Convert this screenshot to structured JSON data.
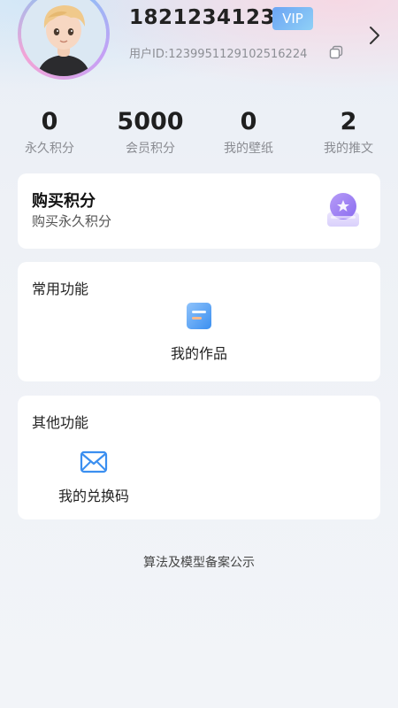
{
  "profile": {
    "phone": "18212341234",
    "vip_label": "VIP",
    "user_id": "用户ID:1239951129102516224"
  },
  "stats": [
    {
      "value": "0",
      "label": "永久积分"
    },
    {
      "value": "5000",
      "label": "会员积分"
    },
    {
      "value": "0",
      "label": "我的壁纸"
    },
    {
      "value": "2",
      "label": "我的推文"
    }
  ],
  "buy_card": {
    "title": "购买积分",
    "subtitle": "购买永久积分"
  },
  "common_functions": {
    "title": "常用功能",
    "items": [
      {
        "label": "我的作品",
        "icon": "document-icon"
      }
    ]
  },
  "other_functions": {
    "title": "其他功能",
    "items": [
      {
        "label": "我的兑换码",
        "icon": "envelope-icon"
      }
    ]
  },
  "footer": {
    "link": "算法及模型备案公示"
  },
  "colors": {
    "vip_gradient_start": "#6ba4f4",
    "accent_blue": "#3b8ff0",
    "accent_purple": "#9b7cf5"
  }
}
